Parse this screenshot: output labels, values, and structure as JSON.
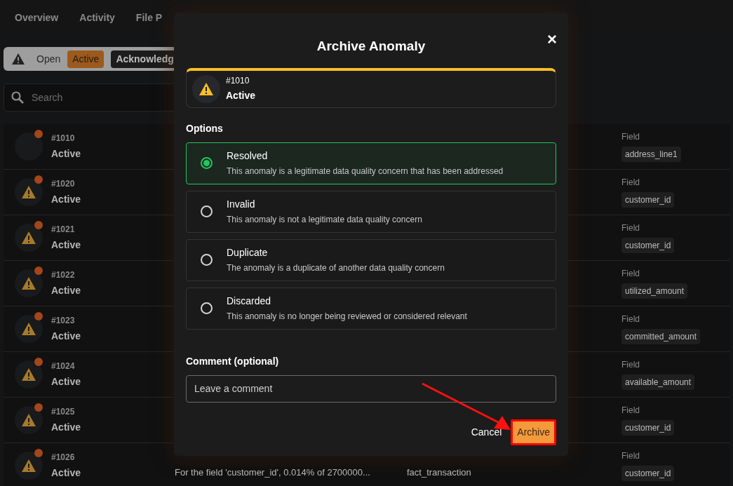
{
  "nav_tabs": [
    {
      "label": "Overview",
      "selected": false
    },
    {
      "label": "Activity",
      "selected": false
    },
    {
      "label": "File P",
      "selected": false
    }
  ],
  "filter_bar": {
    "label": "Open",
    "chips": [
      {
        "label": "Active",
        "selected": true
      },
      {
        "label": "Acknowledg",
        "selected": false
      }
    ]
  },
  "search": {
    "placeholder": "Search"
  },
  "anomalies": [
    {
      "id": "#1010",
      "status": "Active",
      "has_icon": false,
      "field_label": "Field",
      "field": "address_line1"
    },
    {
      "id": "#1020",
      "status": "Active",
      "has_icon": true,
      "field_label": "Field",
      "field": "customer_id"
    },
    {
      "id": "#1021",
      "status": "Active",
      "has_icon": true,
      "field_label": "Field",
      "field": "customer_id"
    },
    {
      "id": "#1022",
      "status": "Active",
      "has_icon": true,
      "field_label": "Field",
      "field": "utilized_amount"
    },
    {
      "id": "#1023",
      "status": "Active",
      "has_icon": true,
      "field_label": "Field",
      "field": "committed_amount"
    },
    {
      "id": "#1024",
      "status": "Active",
      "has_icon": true,
      "field_label": "Field",
      "field": "available_amount"
    },
    {
      "id": "#1025",
      "status": "Active",
      "has_icon": true,
      "field_label": "Field",
      "field": "customer_id"
    },
    {
      "id": "#1026",
      "status": "Active",
      "has_icon": true,
      "field_label": "Field",
      "field": "customer_id",
      "description": "For the field 'customer_id', 0.014% of 2700000...",
      "table": "fact_transaction"
    }
  ],
  "dialog": {
    "title": "Archive Anomaly",
    "close": "×",
    "anomaly": {
      "id": "#1010",
      "status": "Active"
    },
    "options_label": "Options",
    "options": [
      {
        "title": "Resolved",
        "description": "This anomaly is a legitimate data quality concern that has been addressed",
        "selected": true
      },
      {
        "title": "Invalid",
        "description": "This anomaly is not a legitimate data quality concern",
        "selected": false
      },
      {
        "title": "Duplicate",
        "description": "The anomaly is a duplicate of another data quality concern",
        "selected": false
      },
      {
        "title": "Discarded",
        "description": "This anomaly is no longer being reviewed or considered relevant",
        "selected": false
      }
    ],
    "comment_label": "Comment (optional)",
    "comment_placeholder": "Leave a comment",
    "cancel": "Cancel",
    "archive": {
      "label": "Archive",
      "highlighted": true
    }
  }
}
